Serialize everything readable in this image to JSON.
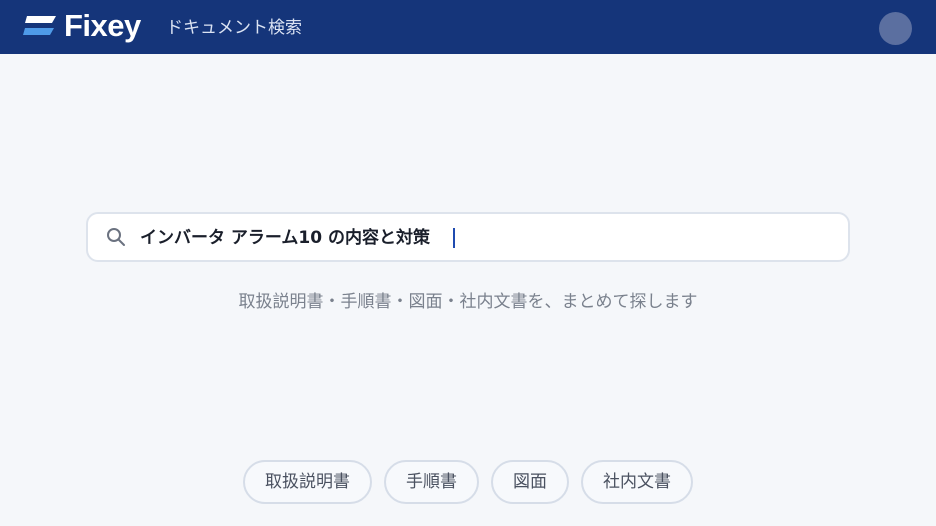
{
  "header": {
    "logo_text": "Fixey",
    "subtitle": "ドキュメント検索",
    "logo_icon": "fixey-logo-mark",
    "avatar_icon": "user-avatar",
    "bg_color": "#15357a"
  },
  "search": {
    "icon": "search-icon",
    "value": "インバータ アラーム10 の内容と対策"
  },
  "tagline": "取扱説明書・手順書・図面・社内文書を、まとめて探します",
  "chips": [
    "取扱説明書",
    "手順書",
    "図面",
    "社内文書"
  ]
}
